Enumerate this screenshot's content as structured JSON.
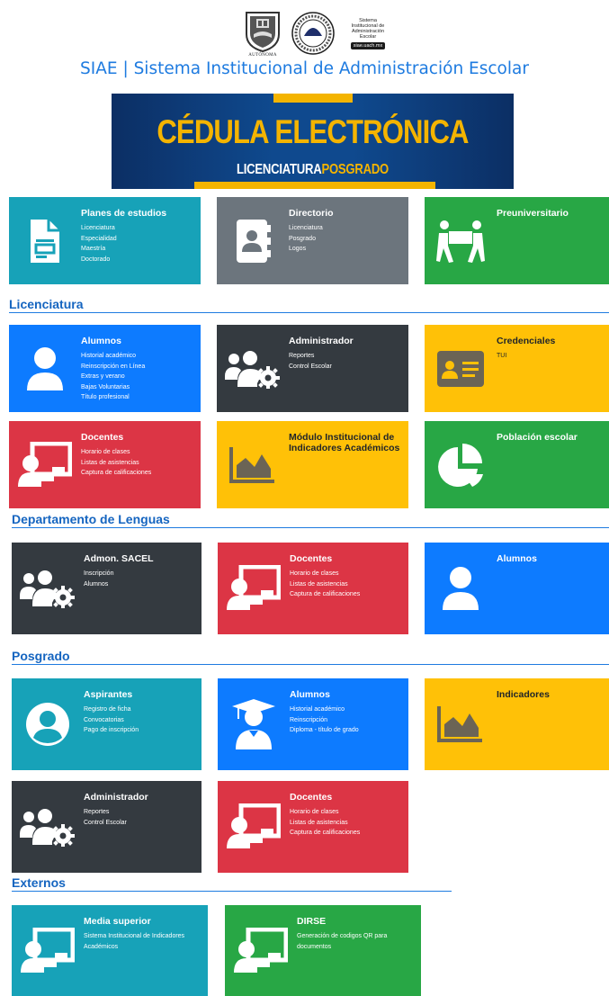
{
  "header": {
    "logo_uach_text": "AUTÓNOMA",
    "logo_caption_lines": [
      "Sistema",
      "Institucional de",
      "Administración",
      "Escolar"
    ],
    "logo_caption_badge": "siae.uach.mx",
    "title": "SIAE | Sistema Institucional de Administración Escolar"
  },
  "banner": {
    "title": "CÉDULA ELECTRÓNICA",
    "sub_part1": "LICENCIATURA",
    "sub_part2": "POSGRADO"
  },
  "top_tiles": [
    {
      "title": "Planes de estudios",
      "links": [
        "Licenciatura",
        "Especialidad",
        "Maestría",
        "Doctorado"
      ],
      "icon": "document-icon",
      "color": "#17a2b8"
    },
    {
      "title": "Directorio",
      "links": [
        "Licenciatura",
        "Posgrado",
        "Logos"
      ],
      "icon": "address-book-icon",
      "color": "#6c757d"
    },
    {
      "title": "Preuniversitario",
      "links": [],
      "icon": "people-carry-icon",
      "color": "#28a745"
    }
  ],
  "sections": {
    "licenciatura": "Licenciatura",
    "lenguas": "Departamento de Lenguas",
    "posgrado": "Posgrado",
    "externos": "Externos"
  },
  "lic_tiles": [
    {
      "title": "Alumnos",
      "links": [
        "Historial académico",
        "Reinscripción en Línea",
        "Extras y verano",
        "Bajas Voluntarias",
        "Título profesional"
      ],
      "icon": "user-icon",
      "color": "#0d7bff"
    },
    {
      "title": "Administrador",
      "links": [
        "Reportes",
        "Control Escolar"
      ],
      "icon": "users-cog-icon",
      "color": "#343a40"
    },
    {
      "title": "Credenciales",
      "links": [
        "TUI"
      ],
      "icon": "id-card-icon",
      "color": "#ffc107"
    },
    {
      "title": "Docentes",
      "links": [
        "Horario de clases",
        "Listas de asistencias",
        "Captura de calificaciones"
      ],
      "icon": "chalkboard-teacher-icon",
      "color": "#dc3545"
    },
    {
      "title": "Módulo Institucional de Indicadores Académicos",
      "links": [],
      "icon": "area-chart-icon",
      "color": "#ffc107"
    },
    {
      "title": "Población escolar",
      "links": [],
      "icon": "pie-chart-icon",
      "color": "#28a745"
    }
  ],
  "len_tiles": [
    {
      "title": "Admon. SACEL",
      "links": [
        "Inscripción",
        "Alumnos"
      ],
      "icon": "users-cog-icon",
      "color": "#343a40"
    },
    {
      "title": "Docentes",
      "links": [
        "Horario de clases",
        "Listas de asistencias",
        "Captura de calificaciones"
      ],
      "icon": "chalkboard-teacher-icon",
      "color": "#dc3545"
    },
    {
      "title": "Alumnos",
      "links": [],
      "icon": "user-icon",
      "color": "#0d7bff"
    }
  ],
  "pos_tiles": [
    {
      "title": "Aspirantes",
      "links": [
        "Registro de ficha",
        "Convocatorias",
        "Pago de inscripción"
      ],
      "icon": "user-circle-icon",
      "color": "#17a2b8"
    },
    {
      "title": "Alumnos",
      "links": [
        "Historial académico",
        "Reinscripción",
        "Diploma - título de grado"
      ],
      "icon": "user-graduate-icon",
      "color": "#0d7bff"
    },
    {
      "title": "Indicadores",
      "links": [],
      "icon": "area-chart-icon",
      "color": "#ffc107"
    },
    {
      "title": "Administrador",
      "links": [
        "Reportes",
        "Control Escolar"
      ],
      "icon": "users-cog-icon",
      "color": "#343a40"
    },
    {
      "title": "Docentes",
      "links": [
        "Horario de clases",
        "Listas de asistencias",
        "Captura de calificaciones"
      ],
      "icon": "chalkboard-teacher-icon",
      "color": "#dc3545"
    }
  ],
  "ext_tiles": [
    {
      "title": "Media superior",
      "links": [
        "Sistema Institucional de Indicadores Académicos"
      ],
      "icon": "chalkboard-teacher-icon",
      "color": "#17a2b8"
    },
    {
      "title": "DIRSE",
      "links": [
        "Generación de codigos QR para documentos"
      ],
      "icon": "chalkboard-teacher-icon",
      "color": "#28a745"
    }
  ]
}
